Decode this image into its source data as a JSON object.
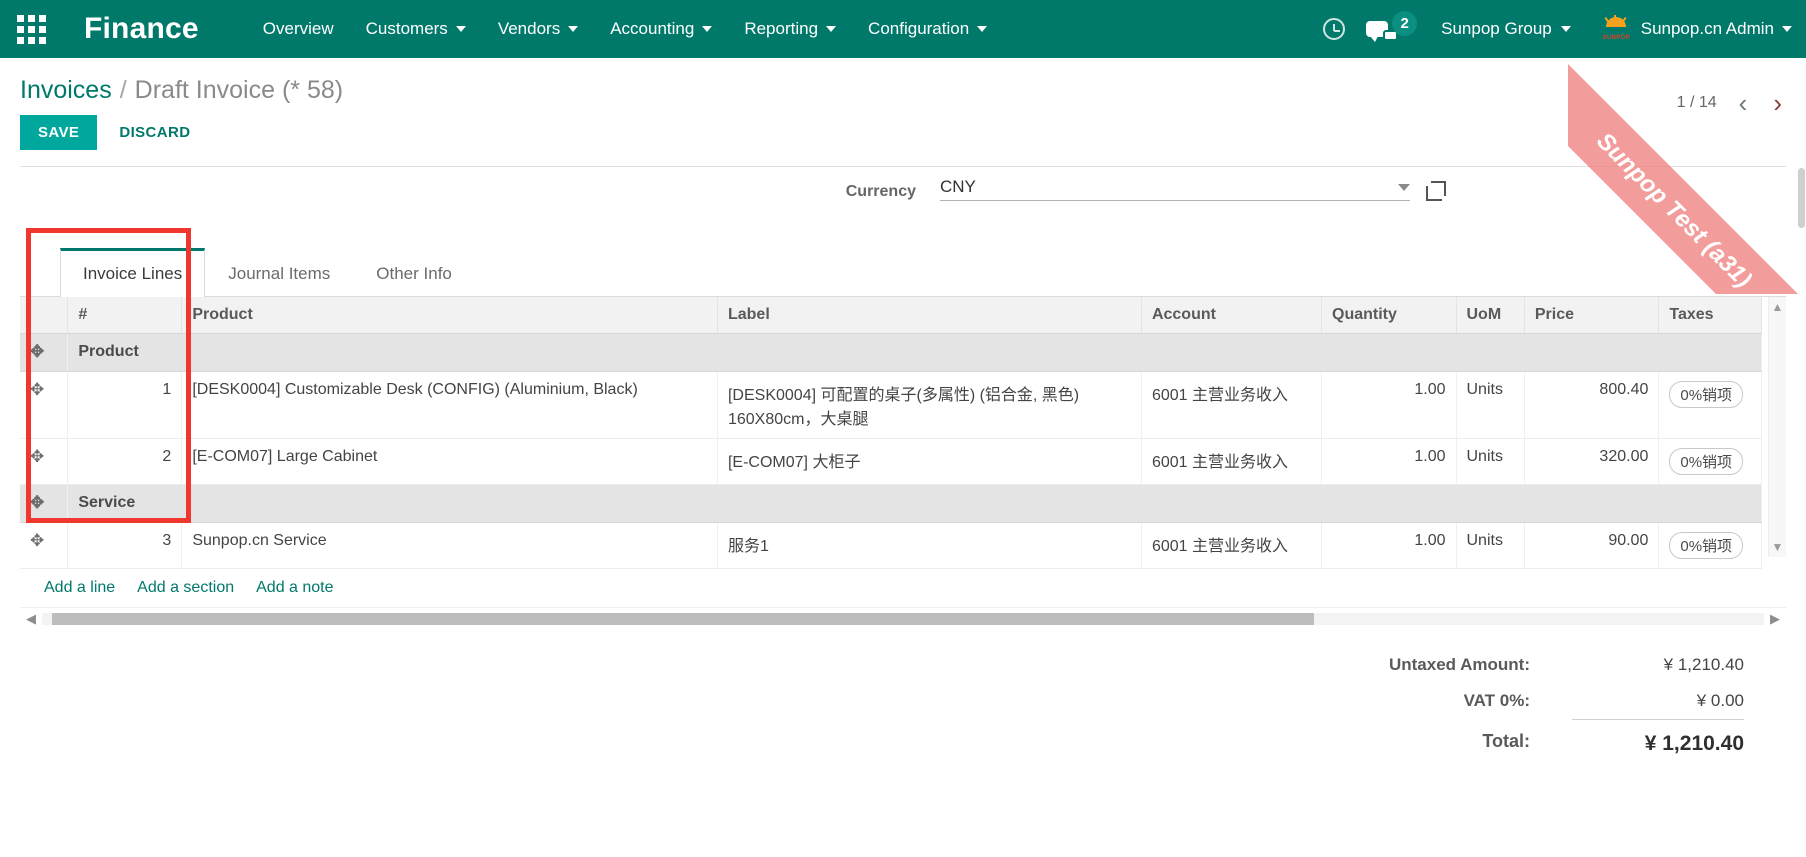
{
  "navbar": {
    "apps_icon": "apps-grid-icon",
    "brand": "Finance",
    "menus": [
      {
        "label": "Overview",
        "has_caret": false
      },
      {
        "label": "Customers",
        "has_caret": true
      },
      {
        "label": "Vendors",
        "has_caret": true
      },
      {
        "label": "Accounting",
        "has_caret": true
      },
      {
        "label": "Reporting",
        "has_caret": true
      },
      {
        "label": "Configuration",
        "has_caret": true
      }
    ],
    "activity_icon": "clock-icon",
    "messages_icon": "chat-bubble-icon",
    "messages_count": "2",
    "company": "Sunpop Group",
    "user_logo": "sunpop-logo-icon",
    "user_logo_text": "SUNPOP",
    "user_name": "Sunpop.cn Admin",
    "ribbon_text": "Sunpop Test (a31)",
    "accent_color": "#00796b",
    "badge_color": "#0b8f80",
    "ribbon_color": "#f08080"
  },
  "control_panel": {
    "breadcrumb_root": "Invoices",
    "breadcrumb_separator": "/",
    "breadcrumb_current": "Draft Invoice (* 58)",
    "save_label": "SAVE",
    "discard_label": "DISCARD",
    "pager_text": "1 / 14",
    "pager_prev": "‹",
    "pager_next": "›"
  },
  "form": {
    "currency_label": "Currency",
    "currency_value": "CNY",
    "currency_dropdown_icon": "chevron-down-icon",
    "currency_external_link_icon": "external-link-icon"
  },
  "tabs": [
    {
      "label": "Invoice Lines",
      "active": true
    },
    {
      "label": "Journal Items",
      "active": false
    },
    {
      "label": "Other Info",
      "active": false
    }
  ],
  "lines_table": {
    "columns": [
      "#",
      "Product",
      "Label",
      "Account",
      "Quantity",
      "UoM",
      "Price",
      "Taxes"
    ],
    "drag_icon": "drag-handle-icon",
    "rows": [
      {
        "type": "section",
        "title": "Product"
      },
      {
        "type": "line",
        "num": "1",
        "product": "[DESK0004] Customizable Desk (CONFIG) (Aluminium, Black)",
        "label_line1": "[DESK0004] 可配置的桌子(多属性) (铝合金, 黑色)",
        "label_line2": "160X80cm，大桌腿",
        "account": "6001 主营业务收入",
        "quantity": "1.00",
        "uom": "Units",
        "price": "800.40",
        "taxes": "0%销项"
      },
      {
        "type": "line",
        "num": "2",
        "product": "[E-COM07] Large Cabinet",
        "label_line1": "[E-COM07] 大柜子",
        "label_line2": "",
        "account": "6001 主营业务收入",
        "quantity": "1.00",
        "uom": "Units",
        "price": "320.00",
        "taxes": "0%销项"
      },
      {
        "type": "section",
        "title": "Service"
      },
      {
        "type": "line",
        "num": "3",
        "product": "Sunpop.cn Service",
        "label_line1": "服务1",
        "label_line2": "",
        "account": "6001 主营业务收入",
        "quantity": "1.00",
        "uom": "Units",
        "price": "90.00",
        "taxes": "0%销项"
      }
    ],
    "add_links": [
      "Add a line",
      "Add a section",
      "Add a note"
    ]
  },
  "totals": {
    "untaxed_label": "Untaxed Amount:",
    "untaxed_value": "¥ 1,210.40",
    "vat_label": "VAT 0%:",
    "vat_value": "¥ 0.00",
    "total_label": "Total:",
    "total_value": "¥ 1,210.40"
  }
}
